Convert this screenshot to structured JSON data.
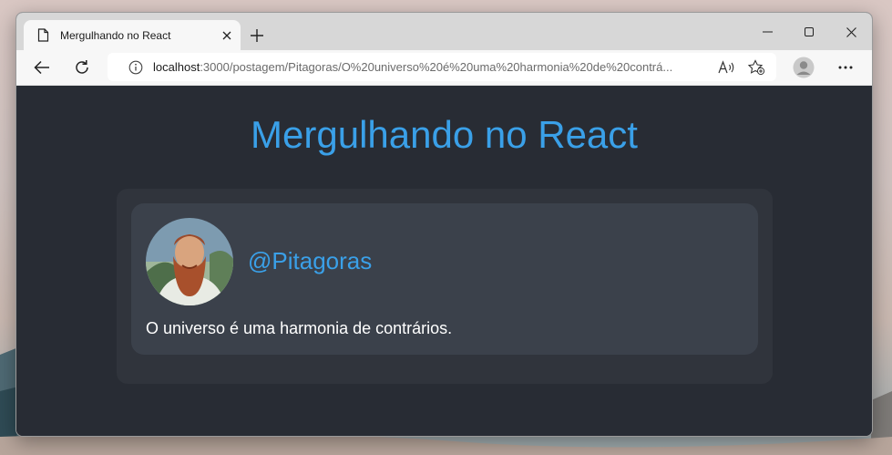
{
  "browser": {
    "tab": {
      "title": "Mergulhando no React"
    },
    "address": {
      "host": "localhost",
      "path": ":3000/postagem/Pitagoras/O%20universo%20é%20uma%20harmonia%20de%20contrá..."
    }
  },
  "page": {
    "title": "Mergulhando no React",
    "post": {
      "username": "@Pitagoras",
      "text": "O universo é uma harmonia de contrários."
    }
  },
  "colors": {
    "accent": "#3aa0e8",
    "background": "#282c34",
    "feed": "#30343c",
    "card": "#3b414b"
  },
  "icons": [
    "page-icon",
    "close-icon",
    "plus-icon",
    "minimize-icon",
    "maximize-icon",
    "window-close-icon",
    "back-arrow-icon",
    "refresh-icon",
    "info-icon",
    "read-aloud-icon",
    "favorites-icon",
    "profile-icon",
    "more-icon"
  ]
}
